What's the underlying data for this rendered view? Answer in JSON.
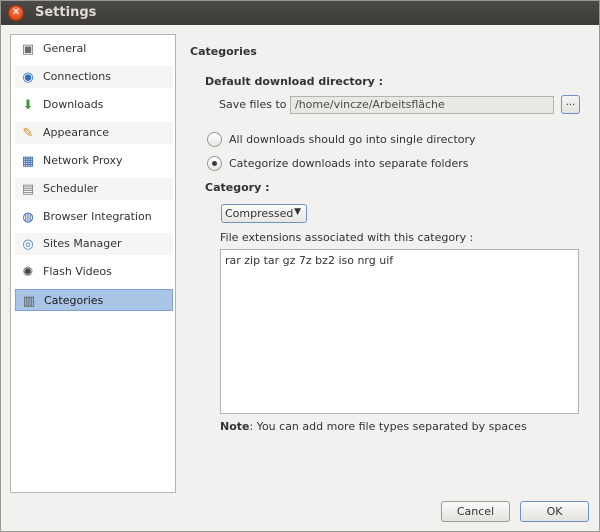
{
  "window": {
    "title": "Settings",
    "close_glyph": "✕"
  },
  "sidebar": {
    "items": [
      {
        "label": "General",
        "icon": "general-icon",
        "glyph": "▣",
        "color": "#6b6b6b"
      },
      {
        "label": "Connections",
        "icon": "connections-icon",
        "glyph": "◉",
        "color": "#2f6fc0"
      },
      {
        "label": "Downloads",
        "icon": "downloads-icon",
        "glyph": "⬇",
        "color": "#3a9a3a"
      },
      {
        "label": "Appearance",
        "icon": "appearance-icon",
        "glyph": "✎",
        "color": "#d88a1e"
      },
      {
        "label": "Network Proxy",
        "icon": "network-proxy-icon",
        "glyph": "▦",
        "color": "#2a5ea8"
      },
      {
        "label": "Scheduler",
        "icon": "scheduler-icon",
        "glyph": "▤",
        "color": "#7a7a7a"
      },
      {
        "label": "Browser Integration",
        "icon": "browser-integration-icon",
        "glyph": "◍",
        "color": "#2a5ea8"
      },
      {
        "label": "Sites Manager",
        "icon": "sites-manager-icon",
        "glyph": "◎",
        "color": "#4a7fc0"
      },
      {
        "label": "Flash Videos",
        "icon": "flash-videos-icon",
        "glyph": "✺",
        "color": "#444444"
      },
      {
        "label": "Categories",
        "icon": "categories-icon",
        "glyph": "▥",
        "color": "#555555"
      }
    ],
    "selected": "Categories"
  },
  "main": {
    "section_title": "Categories",
    "default_dir_label": "Default download directory :",
    "save_files_label": "Save files to :",
    "save_path": "/home/vincze/Arbeitsfläche",
    "browse_label": "...",
    "radio_single": "All downloads should go into single directory",
    "radio_separate": "Categorize downloads into separate folders",
    "selected_radio": "separate",
    "category_label": "Category :",
    "category_value": "Compressed",
    "extensions_label": "File extensions associated with this category :",
    "extensions_value": "rar zip tar gz 7z bz2 iso nrg uif",
    "note_bold": "Note",
    "note_text": ": You can add more file types separated by spaces"
  },
  "buttons": {
    "cancel": "Cancel",
    "ok": "OK"
  },
  "colors": {
    "accent": "#6d93c6",
    "selection": "#a9c4e4",
    "close": "#dd4814"
  }
}
